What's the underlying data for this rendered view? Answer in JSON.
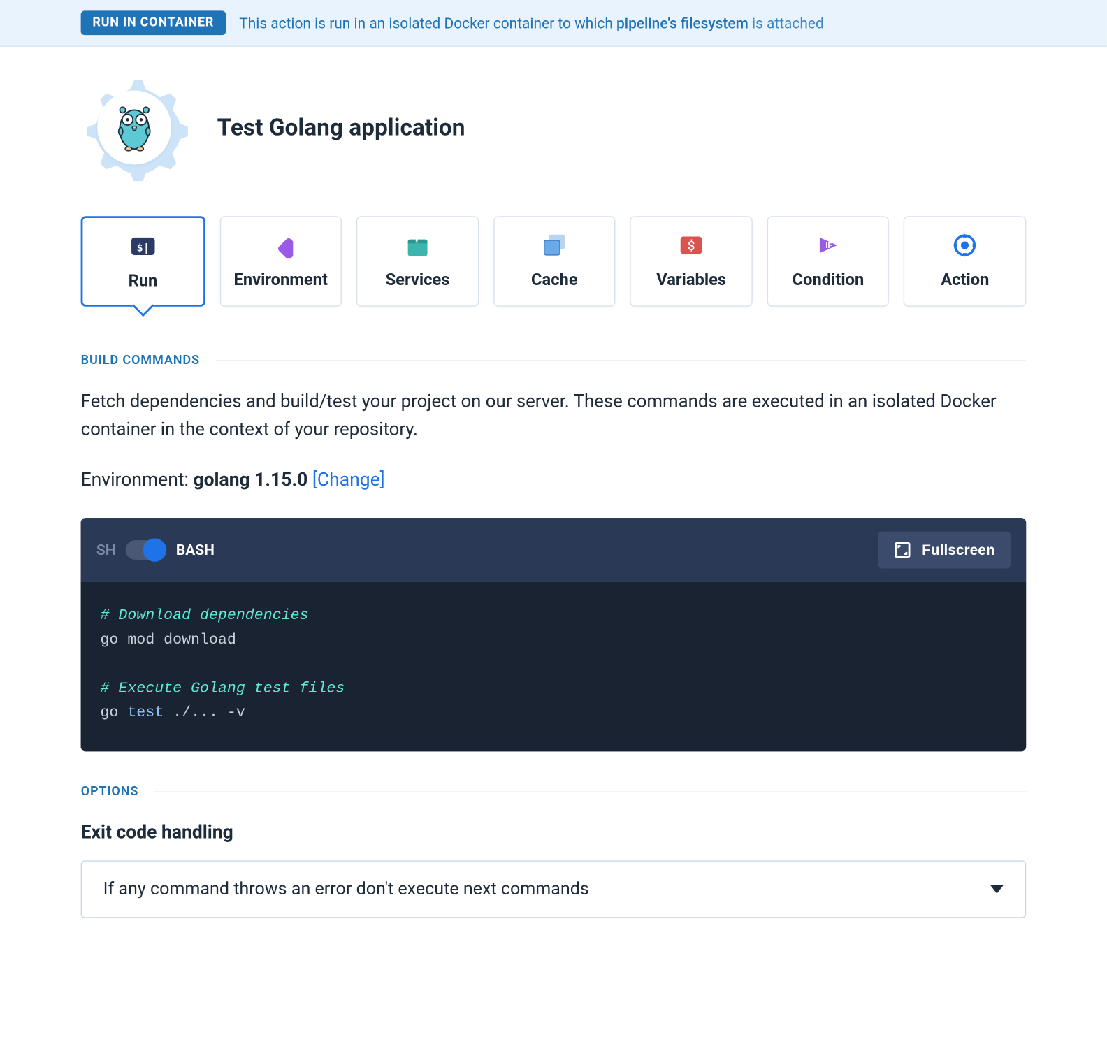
{
  "banner": {
    "chip": "RUN IN CONTAINER",
    "text_pre": "This action is run in an isolated Docker container to which ",
    "link": "pipeline's filesystem",
    "text_post": " is attached"
  },
  "title": "Test Golang application",
  "tabs": [
    {
      "label": "Run",
      "icon": "run",
      "active": true
    },
    {
      "label": "Environment",
      "icon": "environment",
      "active": false
    },
    {
      "label": "Services",
      "icon": "services",
      "active": false
    },
    {
      "label": "Cache",
      "icon": "cache",
      "active": false
    },
    {
      "label": "Variables",
      "icon": "variables",
      "active": false
    },
    {
      "label": "Condition",
      "icon": "condition",
      "active": false
    },
    {
      "label": "Action",
      "icon": "action",
      "active": false
    }
  ],
  "build": {
    "section": "BUILD COMMANDS",
    "description": "Fetch dependencies and build/test your project on our server. These commands are executed in an isolated Docker container in the context of your repository.",
    "env_label": "Environment: ",
    "env_value": "golang 1.15.0",
    "change": "[Change]",
    "sh": "SH",
    "bash": "BASH",
    "fullscreen": "Fullscreen",
    "code": {
      "c1": "# Download dependencies",
      "l1a": "go ",
      "l1b": "mod download",
      "c2": "# Execute Golang test files",
      "l2a": "go ",
      "l2b": "test",
      "l2c": " ./... -v"
    }
  },
  "options": {
    "section": "OPTIONS",
    "exit_label": "Exit code handling",
    "exit_value": "If any command throws an error don't execute next commands"
  },
  "colors": {
    "accent": "#1f73e8",
    "link": "#1f73b7"
  }
}
